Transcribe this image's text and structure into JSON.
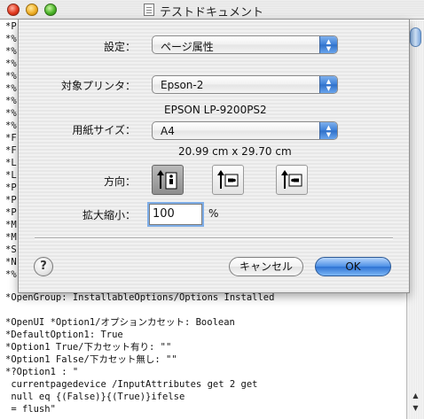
{
  "window": {
    "title": "テストドキュメント"
  },
  "document": {
    "lines_bottom": [
      "*OpenGroup: InstallableOptions/Options Installed",
      "",
      "*OpenUI *Option1/オプションカセット: Boolean",
      "*DefaultOption1: True",
      "*Option1 True/下カセット有り: \"\"",
      "*Option1 False/下カセット無し: \"\"",
      "*?Option1 : \"",
      " currentpagedevice /InputAttributes get 2 get",
      " null eq {(False)}{(True)}ifelse",
      " = flush\""
    ],
    "left_fragments": [
      "*P",
      "*%",
      "*%",
      "*%",
      "*%",
      "*%",
      "*%",
      "*%",
      "*%",
      "*F",
      "*F",
      "*L",
      "*L",
      "*P",
      "*P",
      "*P",
      "*M",
      "*M",
      "*S",
      "*N",
      "*%"
    ]
  },
  "dialog": {
    "settings_label": "設定：",
    "settings_value": "ページ属性",
    "printer_label": "対象プリンタ：",
    "printer_value": "Epson-2",
    "printer_desc": "EPSON LP-9200PS2",
    "paper_label": "用紙サイズ：",
    "paper_value": "A4",
    "paper_dims": "20.99 cm x 29.70 cm",
    "orientation_label": "方向：",
    "scale_label": "拡大縮小：",
    "scale_value": "100",
    "scale_unit": "%",
    "help_label": "?",
    "cancel_label": "キャンセル",
    "ok_label": "OK"
  },
  "colors": {
    "accent": "#3b7fd8"
  }
}
